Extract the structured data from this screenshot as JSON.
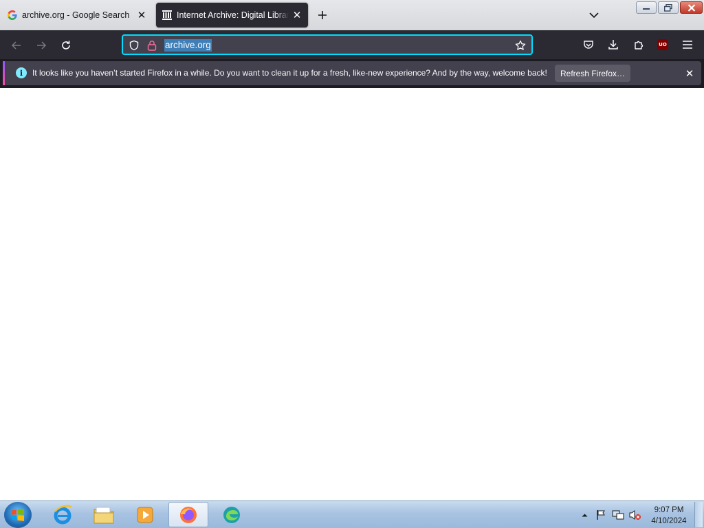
{
  "browser": {
    "tabs": [
      {
        "title": "archive.org - Google Search",
        "favicon": "google-g-icon",
        "active": false
      },
      {
        "title": "Internet Archive: Digital Library of Free & Borrowable Books, Movies, Music & Wayback Machine",
        "favicon": "archive-building-icon",
        "active": true
      }
    ],
    "url": "archive.org",
    "notification": {
      "message": "It looks like you haven’t started Firefox in a while. Do you want to clean it up for a fresh, like-new experience? And by the way, welcome back!",
      "button_label": "Refresh Firefox…"
    },
    "ublock_label": "UO"
  },
  "taskbar": {
    "apps": [
      "internet-explorer-icon",
      "file-explorer-icon",
      "media-player-icon",
      "firefox-icon",
      "edge-icon"
    ],
    "time": "9:07 PM",
    "date": "4/10/2024"
  },
  "colors": {
    "toolbar": "#2b2a33",
    "urlbar_focus": "#00ddff",
    "selection": "#3f7fb7"
  }
}
